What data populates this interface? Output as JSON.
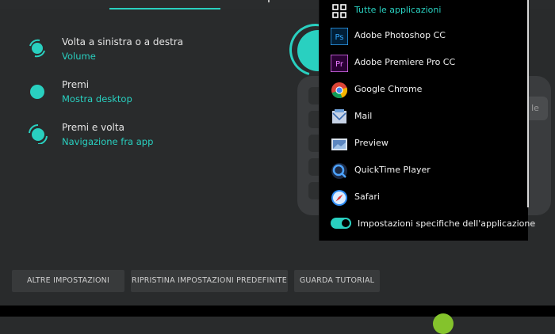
{
  "actions": [
    {
      "title": "Volta a sinistra o a destra",
      "value": "Volume",
      "icon": "rotate-icon"
    },
    {
      "title": "Premi",
      "value": "Mostra desktop",
      "icon": "press-icon"
    },
    {
      "title": "Premi e volta",
      "value": "Navigazione fra app",
      "icon": "press-rotate-icon"
    }
  ],
  "menu": {
    "items": [
      {
        "label": "Tutte le applicazioni",
        "icon": "grid-icon",
        "selected": true
      },
      {
        "label": "Adobe Photoshop CC",
        "icon": "photoshop-icon",
        "abbr": "Ps"
      },
      {
        "label": "Adobe Premiere Pro CC",
        "icon": "premiere-icon",
        "abbr": "Pr"
      },
      {
        "label": "Google Chrome",
        "icon": "chrome-icon"
      },
      {
        "label": "Mail",
        "icon": "mail-icon"
      },
      {
        "label": "Preview",
        "icon": "preview-icon"
      },
      {
        "label": "QuickTime Player",
        "icon": "quicktime-icon"
      },
      {
        "label": "Safari",
        "icon": "safari-icon"
      }
    ],
    "toggle_label": "Impostazioni specifiche dell'applicazione",
    "toggle_on": true
  },
  "keyboard": {
    "key_label": "le"
  },
  "buttons": {
    "more": "ALTRE IMPOSTAZIONI",
    "restore": "RIPRISTINA IMPOSTAZIONI PREDEFINITE",
    "tutorial": "GUARDA TUTORIAL"
  },
  "colors": {
    "accent": "#29d0c0",
    "background": "#292b2c",
    "menu_bg": "#000000"
  }
}
